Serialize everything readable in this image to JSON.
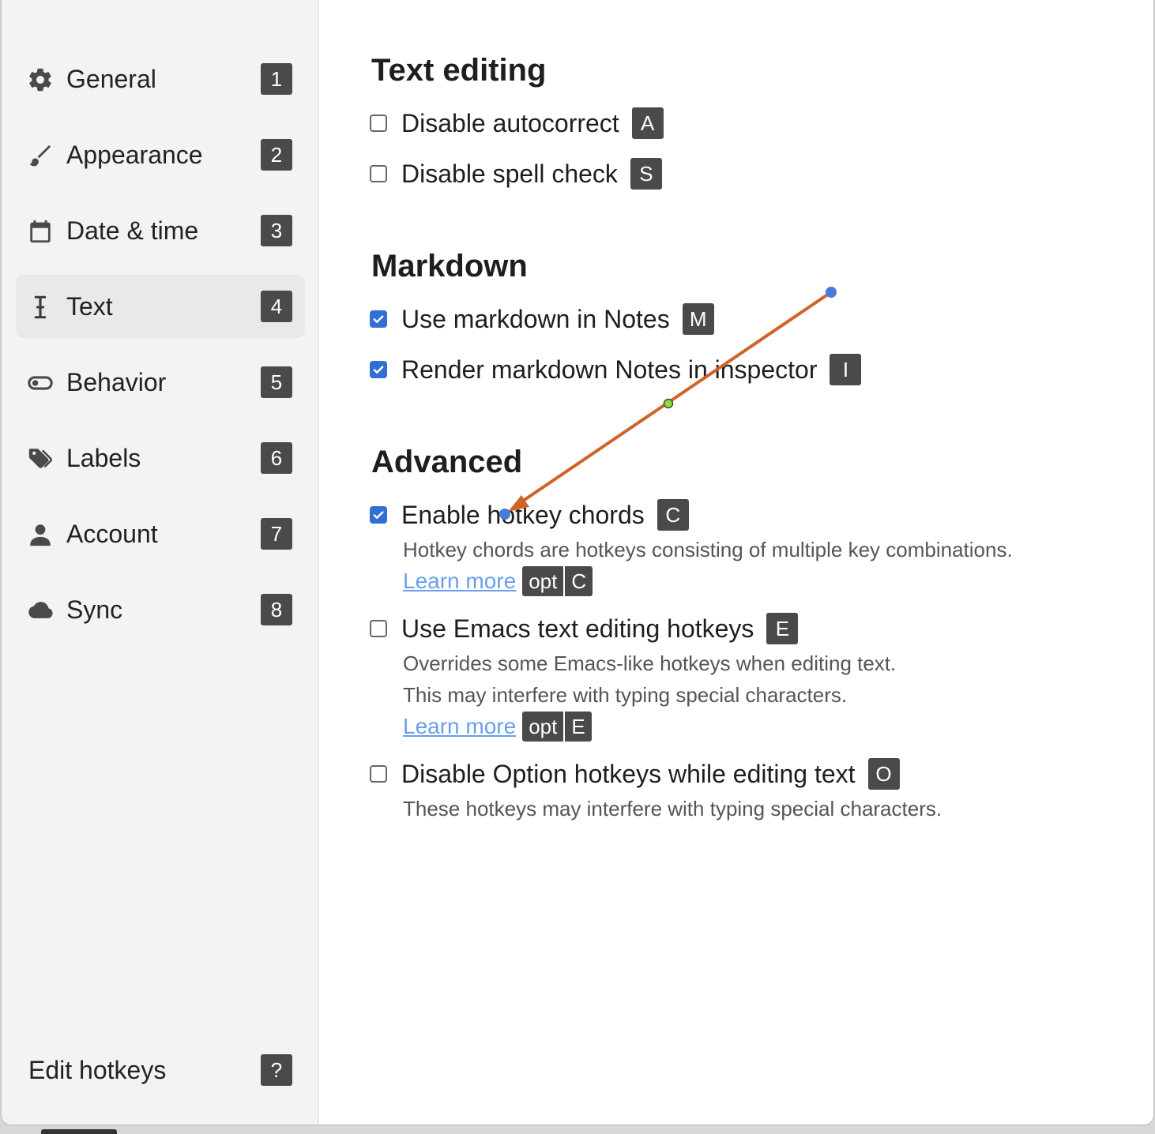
{
  "sidebar": {
    "items": [
      {
        "label": "General",
        "key": "1",
        "icon": "gear-icon"
      },
      {
        "label": "Appearance",
        "key": "2",
        "icon": "brush-icon"
      },
      {
        "label": "Date & time",
        "key": "3",
        "icon": "calendar-icon"
      },
      {
        "label": "Text",
        "key": "4",
        "icon": "text-cursor-icon",
        "active": true
      },
      {
        "label": "Behavior",
        "key": "5",
        "icon": "toggle-icon"
      },
      {
        "label": "Labels",
        "key": "6",
        "icon": "tags-icon"
      },
      {
        "label": "Account",
        "key": "7",
        "icon": "user-icon"
      },
      {
        "label": "Sync",
        "key": "8",
        "icon": "cloud-icon"
      }
    ],
    "footer": {
      "label": "Edit hotkeys",
      "key": "?"
    }
  },
  "main": {
    "text_editing": {
      "title": "Text editing",
      "options": [
        {
          "label": "Disable autocorrect",
          "key": "A",
          "checked": false
        },
        {
          "label": "Disable spell check",
          "key": "S",
          "checked": false
        }
      ]
    },
    "markdown": {
      "title": "Markdown",
      "options": [
        {
          "label": "Use markdown in Notes",
          "key": "M",
          "checked": true
        },
        {
          "label": "Render markdown Notes in inspector",
          "key": "I",
          "checked": true
        }
      ]
    },
    "advanced": {
      "title": "Advanced",
      "hotkey_chords": {
        "label": "Enable hotkey chords",
        "key": "C",
        "checked": true,
        "desc": "Hotkey chords are hotkeys consisting of multiple key combinations.",
        "learn_more": "Learn more",
        "chord": [
          "opt",
          "C"
        ]
      },
      "emacs": {
        "label": "Use Emacs text editing hotkeys",
        "key": "E",
        "checked": false,
        "desc1": "Overrides some Emacs-like hotkeys when editing text.",
        "desc2": "This may interfere with typing special characters.",
        "learn_more": "Learn more",
        "chord": [
          "opt",
          "E"
        ]
      },
      "option_hotkeys": {
        "label": "Disable Option hotkeys while editing text",
        "key": "O",
        "checked": false,
        "desc": "These hotkeys may interfere with typing special characters."
      }
    }
  },
  "colors": {
    "accent": "#2f6fd6",
    "link": "#6a9ff0",
    "key_bg": "#4a4a4a",
    "annotation_arrow": "#d0632a",
    "annotation_handle": "#4a7bd8",
    "annotation_midpoint": "#9ad14a"
  }
}
